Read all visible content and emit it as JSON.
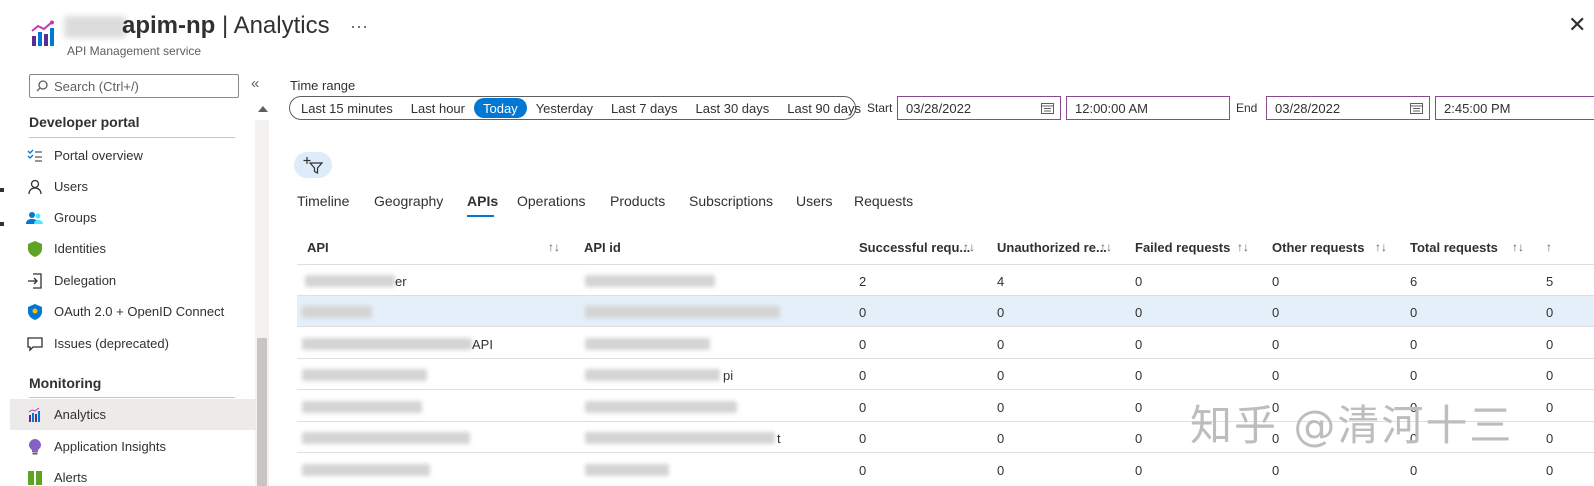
{
  "header": {
    "title_bold": "apim-np",
    "title_rest": " | Analytics",
    "ellipsis": "···",
    "subtitle": "API Management service",
    "close": "✕"
  },
  "sidebar": {
    "search_placeholder": "Search (Ctrl+/)",
    "collapse": "«",
    "sections": [
      {
        "title": "Developer portal"
      },
      {
        "title": "Monitoring"
      }
    ],
    "items": [
      {
        "label": "Portal overview",
        "icon": "checklist-icon"
      },
      {
        "label": "Users",
        "icon": "user-icon"
      },
      {
        "label": "Groups",
        "icon": "groups-icon"
      },
      {
        "label": "Identities",
        "icon": "shield-icon"
      },
      {
        "label": "Delegation",
        "icon": "delegation-icon"
      },
      {
        "label": "OAuth 2.0 + OpenID Connect",
        "icon": "oauth-shield-icon"
      },
      {
        "label": "Issues (deprecated)",
        "icon": "comment-icon"
      },
      {
        "label": "Analytics",
        "icon": "analytics-icon"
      },
      {
        "label": "Application Insights",
        "icon": "lightbulb-icon"
      },
      {
        "label": "Alerts",
        "icon": "alerts-icon"
      }
    ]
  },
  "time_range": {
    "label": "Time range",
    "options": [
      "Last 15 minutes",
      "Last hour",
      "Today",
      "Yesterday",
      "Last 7 days",
      "Last 30 days",
      "Last 90 days"
    ],
    "selected": "Today",
    "start_label": "Start",
    "start_date": "03/28/2022",
    "start_time": "12:00:00 AM",
    "end_label": "End",
    "end_date": "03/28/2022",
    "end_time": "2:45:00 PM"
  },
  "tabs": [
    "Timeline",
    "Geography",
    "APIs",
    "Operations",
    "Products",
    "Subscriptions",
    "Users",
    "Requests"
  ],
  "active_tab": "APIs",
  "table": {
    "columns": [
      "API",
      "API id",
      "Successful requ...",
      "Unauthorized re...",
      "Failed requests",
      "Other requests",
      "Total requests"
    ],
    "rows": [
      {
        "api_suffix": "er",
        "api_id_suffix": "",
        "successful": "2",
        "unauthorized": "4",
        "failed": "0",
        "other": "0",
        "total": "6",
        "extra": "5"
      },
      {
        "api_suffix": "",
        "api_id_suffix": "",
        "successful": "0",
        "unauthorized": "0",
        "failed": "0",
        "other": "0",
        "total": "0",
        "extra": "0"
      },
      {
        "api_suffix": "API",
        "api_id_suffix": "",
        "successful": "0",
        "unauthorized": "0",
        "failed": "0",
        "other": "0",
        "total": "0",
        "extra": "0"
      },
      {
        "api_suffix": "",
        "api_id_suffix": "pi",
        "successful": "0",
        "unauthorized": "0",
        "failed": "0",
        "other": "0",
        "total": "0",
        "extra": "0"
      },
      {
        "api_suffix": "",
        "api_id_suffix": "",
        "successful": "0",
        "unauthorized": "0",
        "failed": "0",
        "other": "0",
        "total": "0",
        "extra": "0"
      },
      {
        "api_suffix": "",
        "api_id_suffix": "t",
        "successful": "0",
        "unauthorized": "0",
        "failed": "0",
        "other": "0",
        "total": "0",
        "extra": "0"
      },
      {
        "api_suffix": "",
        "api_id_suffix": "",
        "successful": "0",
        "unauthorized": "0",
        "failed": "0",
        "other": "0",
        "total": "0",
        "extra": "0"
      }
    ],
    "sort_icon": "↑↓"
  },
  "watermark": "知乎 @清河十三",
  "colors": {
    "accent": "#0078d4",
    "selected_row": "#e4eff9",
    "field_border": "#8a4a8e"
  }
}
